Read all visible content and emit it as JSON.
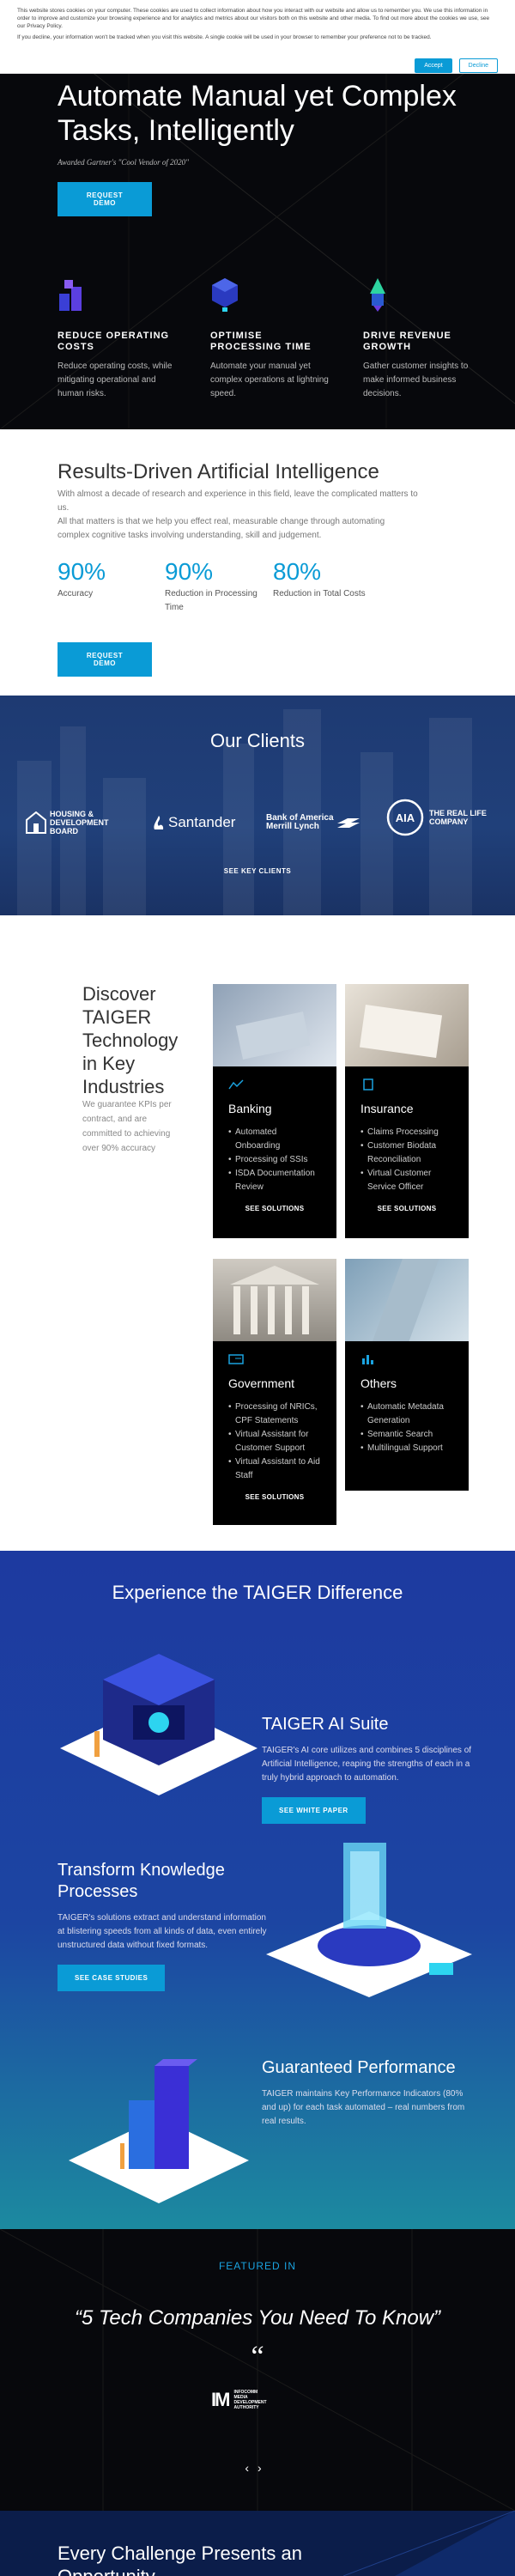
{
  "cookie": {
    "text1": "This website stores cookies on your computer. These cookies are used to collect information about how you interact with our website and allow us to remember you. We use this information in order to improve and customize your browsing experience and for analytics and metrics about our visitors both on this website and other media. To find out more about the cookies we use, see our Privacy Policy.",
    "text2": "If you decline, your information won't be tracked when you visit this website. A single cookie will be used in your browser to remember your preference not to be tracked.",
    "accept": "Accept",
    "decline": "Decline"
  },
  "hero": {
    "title": "Automate Manual yet Complex Tasks, Intelligently",
    "award": "Awarded Gartner's \"Cool Vendor of 2020\"",
    "cta": "REQUEST DEMO",
    "features": [
      {
        "title": "REDUCE OPERATING COSTS",
        "text": "Reduce operating costs, while mitigating operational and human risks."
      },
      {
        "title": "OPTIMISE PROCESSING TIME",
        "text": "Automate your manual yet complex operations at lightning speed."
      },
      {
        "title": "DRIVE REVENUE GROWTH",
        "text": "Gather customer insights to make informed business decisions."
      }
    ]
  },
  "results": {
    "title": "Results-Driven Artificial Intelligence",
    "p1": "With almost a decade of research and experience in this field, leave the complicated matters to us.",
    "p2": "All that matters is that we help you effect real, measurable change through automating complex cognitive tasks involving understanding, skill and judgement.",
    "stats": [
      {
        "num": "90%",
        "label": "Accuracy"
      },
      {
        "num": "90%",
        "label": "Reduction in Processing Time"
      },
      {
        "num": "80%",
        "label": "Reduction in Total Costs"
      }
    ],
    "cta": "REQUEST DEMO"
  },
  "clients": {
    "title": "Our Clients",
    "logos": {
      "hdb": "HOUSING & DEVELOPMENT BOARD",
      "santander": "Santander",
      "boa1": "Bank of America",
      "boa2": "Merrill Lynch",
      "aia": "AIA",
      "aia_tag1": "THE REAL LIFE",
      "aia_tag2": "COMPANY"
    },
    "see": "SEE KEY CLIENTS"
  },
  "industries": {
    "title": "Discover TAIGER Technology in Key Industries",
    "intro": "We guarantee KPIs per contract, and are committed to achieving over 90% accuracy",
    "cards": [
      {
        "title": "Banking",
        "items": [
          "Automated Onboarding",
          "Processing of SSIs",
          "ISDA Documentation Review"
        ],
        "cta": "SEE SOLUTIONS"
      },
      {
        "title": "Insurance",
        "items": [
          "Claims Processing",
          "Customer Biodata Reconciliation",
          "Virtual Customer Service Officer"
        ],
        "cta": "SEE SOLUTIONS"
      },
      {
        "title": "Government",
        "items": [
          "Processing of NRICs, CPF Statements",
          "Virtual Assistant for Customer Support",
          "Virtual Assistant to Aid Staff"
        ],
        "cta": "SEE SOLUTIONS"
      },
      {
        "title": "Others",
        "items": [
          "Automatic Metadata Generation",
          "Semantic Search",
          "Multilingual Support"
        ],
        "cta": ""
      }
    ]
  },
  "experience": {
    "title": "Experience the TAIGER Difference",
    "blocks": [
      {
        "title": "TAIGER AI Suite",
        "text": "TAIGER's AI core utilizes and combines 5 disciplines of Artificial Intelligence, reaping the strengths of each in a truly hybrid approach to automation.",
        "cta": "SEE WHITE PAPER"
      },
      {
        "title": "Transform Knowledge Processes",
        "text": "TAIGER's solutions extract and understand information at blistering speeds from all kinds of data, even entirely unstructured data without fixed formats.",
        "cta": "SEE CASE STUDIES"
      },
      {
        "title": "Guaranteed Performance",
        "text": "TAIGER maintains Key Performance Indicators (80% and up) for each task automated – real numbers from real results.",
        "cta": ""
      }
    ]
  },
  "featured": {
    "label": "FEATURED IN",
    "quote": "“5 Tech Companies You Need To Know”",
    "mark": "“",
    "imda_mark": "IM",
    "imda_text1": "INFOCOMM",
    "imda_text2": "MEDIA",
    "imda_text3": "DEVELOPMENT",
    "imda_text4": "AUTHORITY",
    "prev": "‹",
    "next": "›"
  },
  "bottom": {
    "title": "Every Challenge Presents an Opportunity"
  },
  "colors": {
    "accent": "#0a9bd6",
    "dark": "#07080c",
    "navy": "#1e3a72"
  }
}
